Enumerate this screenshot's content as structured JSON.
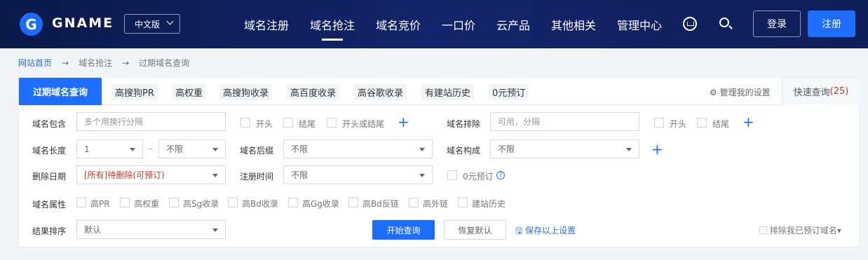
{
  "nav": {
    "logo_letter": "G",
    "brand": "GNAME",
    "lang": "中文版",
    "menu": [
      "域名注册",
      "域名抢注",
      "域名竞价",
      "一口价",
      "云产品",
      "其他相关",
      "管理中心"
    ],
    "login": "登录",
    "register": "注册"
  },
  "breadcrumb": {
    "home": "网站首页",
    "level2": "域名抢注",
    "level3": "过期域名查询",
    "sep": "→"
  },
  "tabs": {
    "main": "过期域名查询",
    "chips": [
      "高搜狗PR",
      "高权重",
      "高搜狗收录",
      "高百度收录",
      "高谷歌收录",
      "有建站历史",
      "0元预订"
    ],
    "my_settings": "管理我的设置",
    "quick_label": "快速查询",
    "quick_count": "(25)"
  },
  "form": {
    "contains_label": "域名包含",
    "contains_placeholder": "多个用换行分隔",
    "opt_start": "开头",
    "opt_end": "结尾",
    "opt_start_or_end": "开头或结尾",
    "exclude_label": "域名排除",
    "exclude_placeholder": "可用，分隔",
    "length_label": "域名长度",
    "length_min": "1",
    "length_sep": "–",
    "length_max": "不限",
    "suffix_label": "域名后缀",
    "suffix_value": "不限",
    "composition_label": "域名构成",
    "composition_value": "不限",
    "delete_label": "删除日期",
    "delete_value": "[所有]待删除(可预订)",
    "regtime_label": "注册时间",
    "regtime_value": "不限",
    "zero_price": "0元预订",
    "attr_label": "域名属性",
    "attrs": [
      "高PR",
      "高权重",
      "高Sg收录",
      "高Bd收录",
      "高Gg收录",
      "高Bd反链",
      "高外链",
      "建站历史"
    ],
    "sort_label": "结果排序",
    "sort_value": "默认",
    "start_btn": "开始查询",
    "reset_btn": "恢复默认",
    "save_link": "保存以上设置",
    "exclude_mine": "排除我已预订域名"
  }
}
